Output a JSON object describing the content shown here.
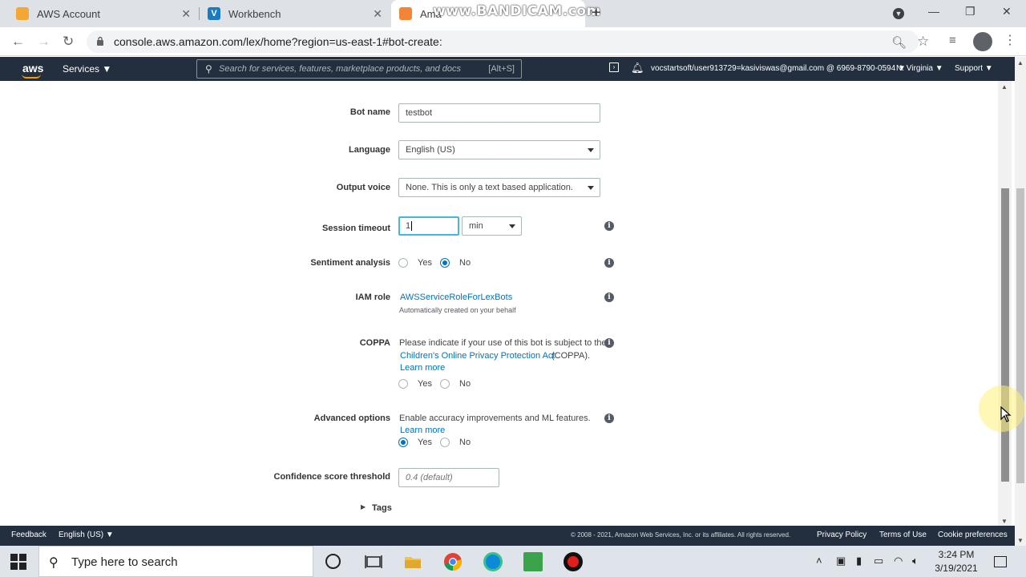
{
  "browser": {
    "tabs": [
      {
        "title": "AWS Account",
        "favicon_color": "#f3a735"
      },
      {
        "title": "Workbench",
        "favicon_color": "#1c7bc0"
      },
      {
        "title": "Ama",
        "favicon_color": "#f58536"
      }
    ],
    "watermark": "www.BANDICAM.com",
    "url": "console.aws.amazon.com/lex/home?region=us-east-1#bot-create:"
  },
  "aws_nav": {
    "logo": "aws",
    "services": "Services ▼",
    "search_placeholder": "Search for services, features, marketplace products, and docs",
    "search_shortcut": "[Alt+S]",
    "account": "vocstartsoft/user913729=kasiviswas@gmail.com @ 6969-8790-0594 ▼",
    "region": "N. Virginia ▼",
    "support": "Support ▼"
  },
  "form": {
    "bot_name": {
      "label": "Bot name",
      "value": "testbot"
    },
    "language": {
      "label": "Language",
      "value": "English (US)"
    },
    "output_voice": {
      "label": "Output voice",
      "value": "None. This is only a text based application."
    },
    "session_timeout": {
      "label": "Session timeout",
      "value": "1",
      "unit": "min"
    },
    "sentiment": {
      "label": "Sentiment analysis",
      "yes": "Yes",
      "no": "No",
      "selected": "No"
    },
    "iam_role": {
      "label": "IAM role",
      "link": "AWSServiceRoleForLexBots",
      "note": "Automatically created on your behalf"
    },
    "coppa": {
      "label": "COPPA",
      "text1": "Please indicate if your use of this bot is subject to the",
      "link": "Children's Online Privacy Protection Act",
      "text2": "(COPPA).",
      "learn_more": "Learn more",
      "yes": "Yes",
      "no": "No",
      "selected": ""
    },
    "advanced": {
      "label": "Advanced options",
      "text": "Enable accuracy improvements and ML features.",
      "learn_more": "Learn more",
      "yes": "Yes",
      "no": "No",
      "selected": "Yes"
    },
    "confidence": {
      "label": "Confidence score threshold",
      "placeholder": "0.4 (default)"
    },
    "tags": {
      "label": "Tags"
    }
  },
  "aws_footer": {
    "feedback": "Feedback",
    "language": "English (US) ▼",
    "copyright": "© 2008 - 2021, Amazon Web Services, Inc. or its affiliates. All rights reserved.",
    "privacy": "Privacy Policy",
    "terms": "Terms of Use",
    "cookies": "Cookie preferences"
  },
  "taskbar": {
    "search_placeholder": "Type here to search",
    "time": "3:24 PM",
    "date": "3/19/2021"
  }
}
